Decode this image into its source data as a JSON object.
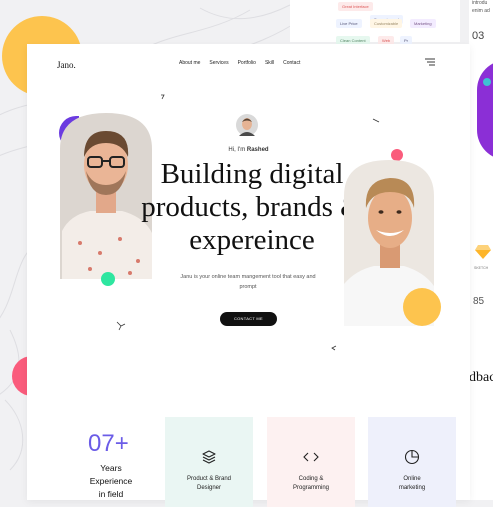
{
  "background_card": {
    "tags": [
      "Great Interface",
      "Supersimmed",
      "Live Price",
      "Customizable",
      "Marketing",
      "Clean Content",
      "Web",
      "Pr"
    ]
  },
  "right_panel": {
    "top_text": "introdu",
    "top_text2": "enim ad",
    "number": "03",
    "percent": "85",
    "sketch_label": "SKETCH",
    "partial_word": "dbac"
  },
  "header": {
    "logo": "Jano.",
    "nav": [
      "About me",
      "Services",
      "Portfolio",
      "Skill",
      "Contact"
    ]
  },
  "hero": {
    "greeting_prefix": "Hi, I'm ",
    "greeting_name": "Rashed",
    "title_lines": [
      "Building digital",
      "products, brands &",
      "expereince"
    ],
    "description": "Janu is your online team mangement tool that easy and prompt",
    "cta_label": "CONTACT ME"
  },
  "stats": {
    "number": "07+",
    "label_lines": [
      "Years",
      "Experience",
      "in field"
    ]
  },
  "services": [
    {
      "label_lines": [
        "Product & Brand",
        "Designer"
      ],
      "icon": "layers-icon",
      "bg": "#eaf6f3"
    },
    {
      "label_lines": [
        "Coding &",
        "Programming"
      ],
      "icon": "code-icon",
      "bg": "#fdf1f1"
    },
    {
      "label_lines": [
        "Online",
        "marketing"
      ],
      "icon": "pie-chart-icon",
      "bg": "#eef0fb"
    }
  ],
  "colors": {
    "accent_purple": "#6b5ce7",
    "accent_yellow": "#fdc44e",
    "accent_pink": "#fa5c7c",
    "accent_green": "#2ee6a0",
    "dark": "#111111"
  }
}
